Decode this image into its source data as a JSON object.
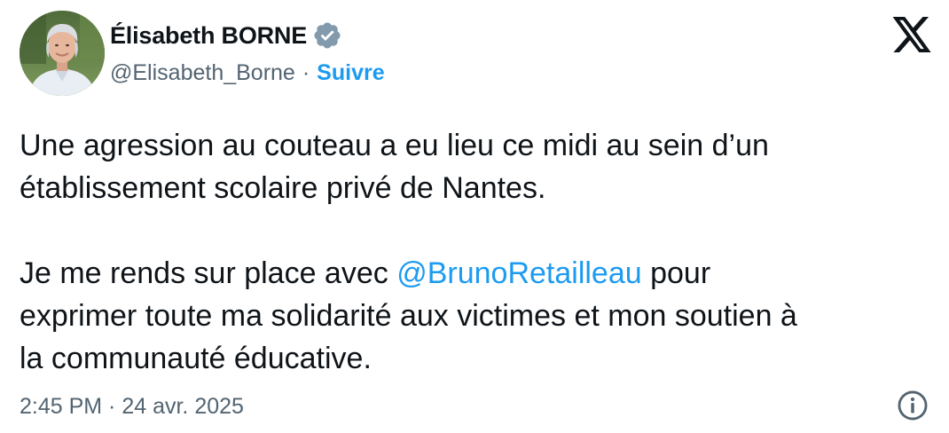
{
  "author": {
    "display_name": "Élisabeth BORNE",
    "handle": "@Elisabeth_Borne",
    "separator": "·",
    "follow_label": "Suivre",
    "verified_icon": "verified-badge-icon"
  },
  "tweet": {
    "line1": "Une agression au couteau a eu lieu ce midi au sein d’un",
    "line2": "établissement scolaire privé de Nantes.",
    "line3_before": "Je me rends sur place avec ",
    "mention": "@BrunoRetailleau",
    "line3_after": " pour",
    "line4": "exprimer toute ma solidarité aux victimes et mon soutien à",
    "line5": "la communauté éducative."
  },
  "footer": {
    "timestamp": "2:45 PM · 24 avr. 2025"
  },
  "icons": {
    "logo": "x-logo-icon",
    "info": "info-icon"
  },
  "colors": {
    "accent": "#1d9bf0",
    "text": "#0f1419",
    "secondary": "#536471",
    "verified": "#829aab"
  }
}
